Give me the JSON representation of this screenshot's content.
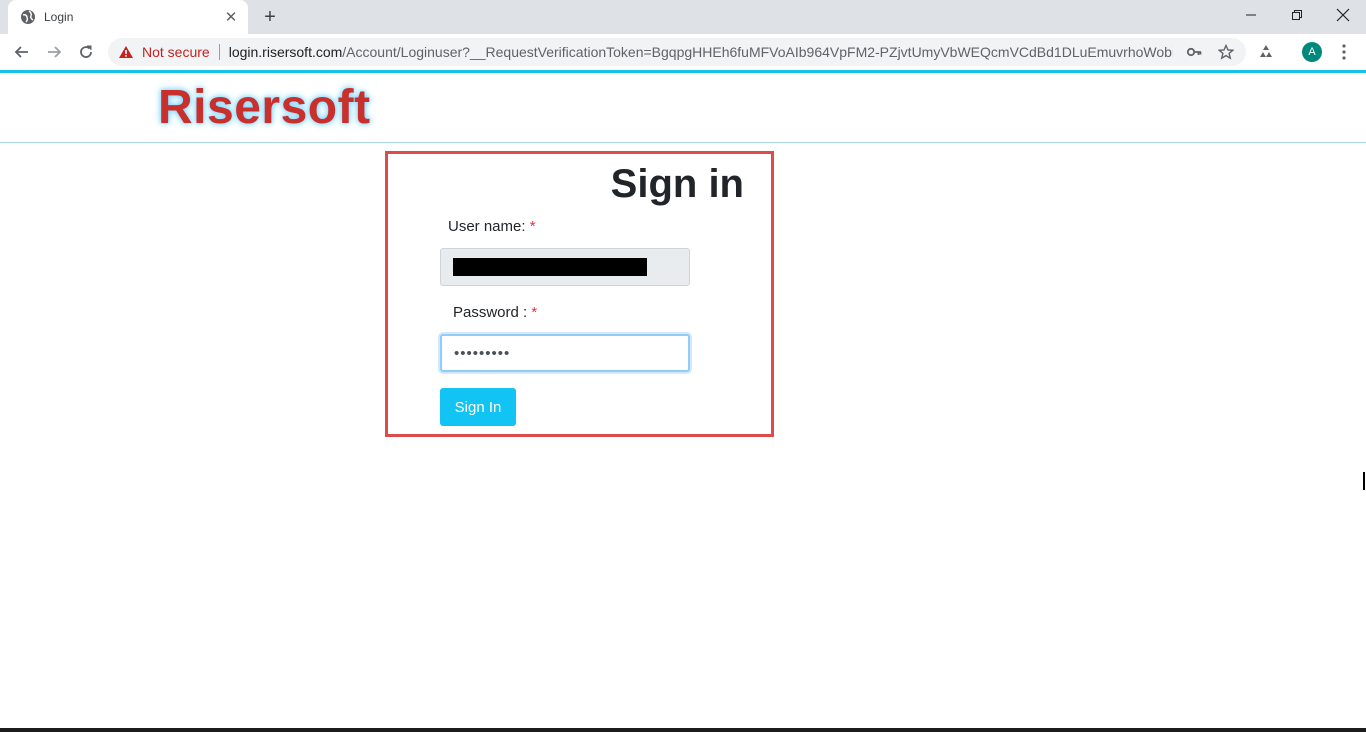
{
  "browser": {
    "tab": {
      "title": "Login",
      "favicon": "globe-icon",
      "close_glyph": "✕"
    },
    "new_tab_glyph": "+",
    "window_controls": {
      "minimize": "minimize-icon",
      "restore": "restore-icon",
      "close": "close-icon"
    },
    "address_bar": {
      "security_label": "Not secure",
      "url_host": "login.risersoft.com",
      "url_rest": "/Account/Loginuser?__RequestVerificationToken=BgqpgHHEh6fuMFVoAIb964VpFM2-PZjvtUmyVbWEQcmVCdBd1DLuEmuvrhoWobii..."
    },
    "profile_initial": "A",
    "colors": {
      "accent": "#17c1e8",
      "warning": "#c5221f",
      "avatar": "#00897b"
    }
  },
  "site": {
    "logo_text": "Risersoft"
  },
  "signin": {
    "title": "Sign in",
    "username_label": "User name:",
    "password_label": "Password :",
    "required_mark": "*",
    "password_value": "•••••••••",
    "button_label": "Sign In",
    "colors": {
      "box_border": "#dd4b4b",
      "button": "#12c4f3",
      "required": "#dc3545"
    }
  }
}
